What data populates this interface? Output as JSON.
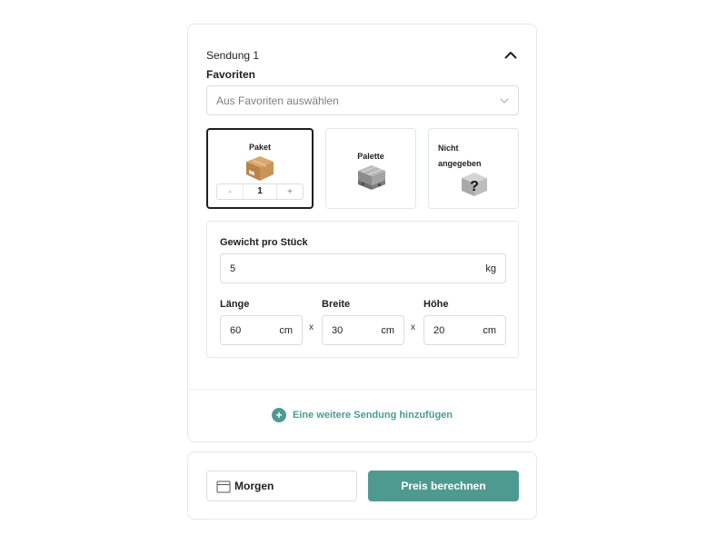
{
  "shipment": {
    "title": "Sendung 1",
    "favorites_label": "Favoriten",
    "favorites_placeholder": "Aus Favoriten auswählen"
  },
  "package_types": {
    "paket": {
      "label": "Paket",
      "selected": true,
      "quantity": "1",
      "minus": "-",
      "plus": "+"
    },
    "palette": {
      "label": "Palette"
    },
    "nicht": {
      "label_line1": "Nicht",
      "label_line2": "angegeben"
    }
  },
  "dimensions": {
    "weight_label": "Gewicht pro Stück",
    "weight_value": "5",
    "weight_unit": "kg",
    "length_label": "Länge",
    "length_value": "60",
    "width_label": "Breite",
    "width_value": "30",
    "height_label": "Höhe",
    "height_value": "20",
    "unit_cm": "cm",
    "times": "x"
  },
  "add_shipment_label": "Eine weitere Sendung hinzufügen",
  "footer": {
    "date_value": "Morgen",
    "calculate_label": "Preis berechnen"
  },
  "colors": {
    "accent": "#4f9a90",
    "border": "#e6e8ea",
    "selected_border": "#1f1f1f"
  },
  "icons": {
    "collapse": "chevron-up-icon",
    "select": "chevron-down-icon",
    "paket": "box-icon",
    "palette": "pallet-icon",
    "nicht": "question-mark-icon",
    "add": "plus-circle-icon",
    "date": "calendar-icon"
  }
}
